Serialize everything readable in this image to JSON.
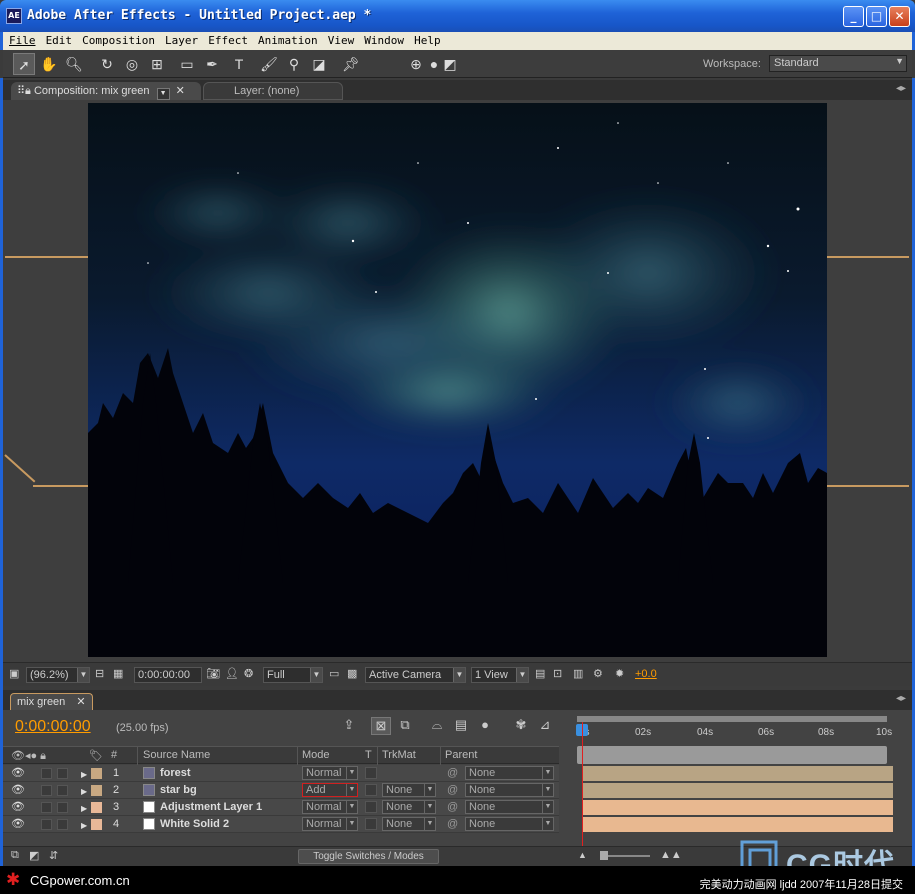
{
  "window": {
    "title": "Adobe After Effects - Untitled Project.aep *",
    "icon_label": "AE",
    "minimize": "_",
    "maximize": "□",
    "close": "✕"
  },
  "menu": [
    "File",
    "Edit",
    "Composition",
    "Layer",
    "Effect",
    "Animation",
    "View",
    "Window",
    "Help"
  ],
  "toolbar": {
    "workspace_label": "Workspace:",
    "workspace_value": "Standard"
  },
  "comp_panel": {
    "comp_tab": "Composition: mix green",
    "layer_tab": "Layer: (none)",
    "controls": {
      "zoom": "(96.2%)",
      "timecode": "0:00:00:00",
      "resolution": "Full",
      "camera": "Active Camera",
      "views": "1 View",
      "exposure": "+0.0"
    }
  },
  "timeline": {
    "tab": "mix green",
    "timecode": "0:00:00:00",
    "fps": "(25.00 fps)",
    "columns": {
      "number": "#",
      "source_name": "Source Name",
      "mode": "Mode",
      "t": "T",
      "trkmat": "TrkMat",
      "parent": "Parent"
    },
    "ruler_labels": [
      "0s",
      "02s",
      "04s",
      "06s",
      "08s",
      "10s"
    ],
    "layers": [
      {
        "num": "1",
        "name": "forest",
        "mode": "Normal",
        "trkmat": "",
        "parent": "None",
        "label_color": "#c8a882",
        "icon": "footage-icon",
        "bar_color": "#b8a484"
      },
      {
        "num": "2",
        "name": "star bg",
        "mode": "Add",
        "trkmat": "None",
        "parent": "None",
        "label_color": "#c8a882",
        "icon": "footage-icon",
        "bar_color": "#b8a484"
      },
      {
        "num": "3",
        "name": "Adjustment Layer 1",
        "mode": "Normal",
        "trkmat": "None",
        "parent": "None",
        "label_color": "#e8b898",
        "icon": "solid-icon",
        "bar_color": "#e8b890"
      },
      {
        "num": "4",
        "name": "White Solid 2",
        "mode": "Normal",
        "trkmat": "None",
        "parent": "None",
        "label_color": "#e8b898",
        "icon": "solid-icon",
        "bar_color": "#e8b890"
      }
    ],
    "toggle_label": "Toggle Switches / Modes"
  },
  "footer": {
    "left": "CGpower.com.cn",
    "right": "完美动力动画网 ljdd 2007年11月28日提交",
    "logo": "CG时代"
  }
}
